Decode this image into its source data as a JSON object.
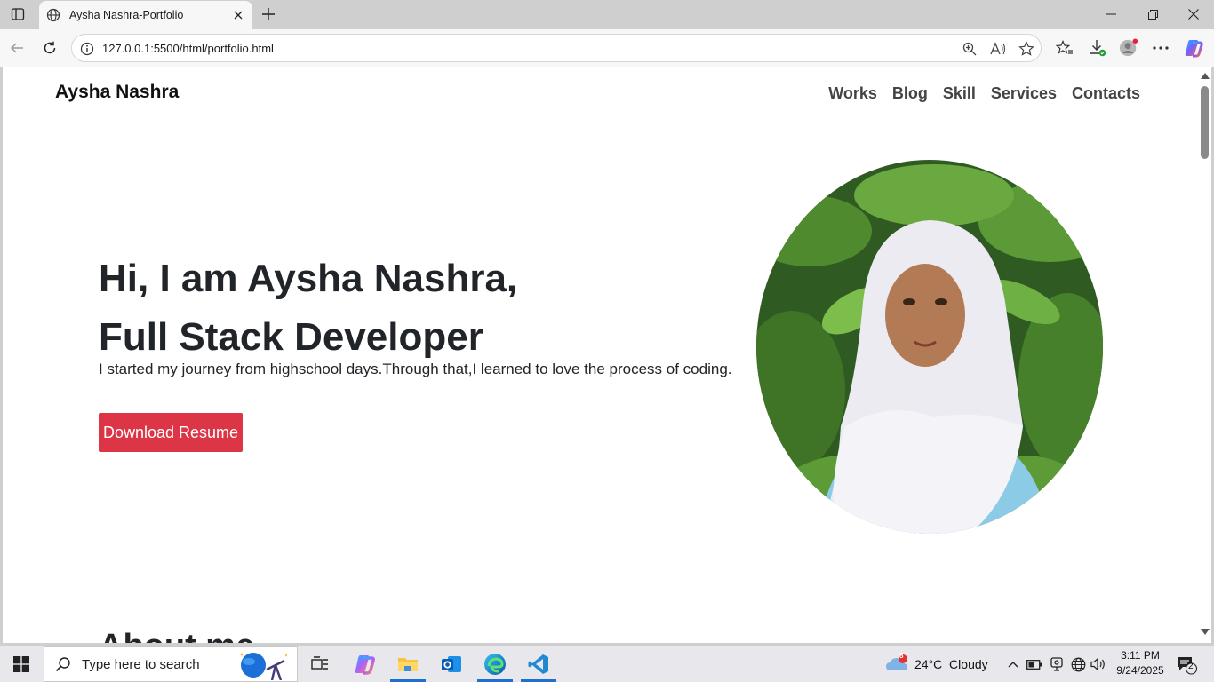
{
  "browser": {
    "tab_title": "Aysha Nashra-Portfolio",
    "url": "127.0.0.1:5500/html/portfolio.html"
  },
  "site": {
    "brand": "Aysha Nashra",
    "nav": [
      "Works",
      "Blog",
      "Skill",
      "Services",
      "Contacts"
    ],
    "hero": {
      "line1": "Hi, I am Aysha Nashra,",
      "line2": "Full Stack Developer",
      "intro": "I started my journey from highschool days.Through that,I learned to love the process of coding.",
      "button": "Download Resume"
    },
    "about_heading": "About me"
  },
  "taskbar": {
    "search_placeholder": "Type here to search",
    "weather_badge": "8",
    "weather": "24°C  Cloudy",
    "time": "3:11 PM",
    "date": "9/24/2025",
    "notifications": "2"
  },
  "colors": {
    "accent": "#dc3545",
    "text": "#212529",
    "taskbar_bg": "#e8e8ec"
  }
}
